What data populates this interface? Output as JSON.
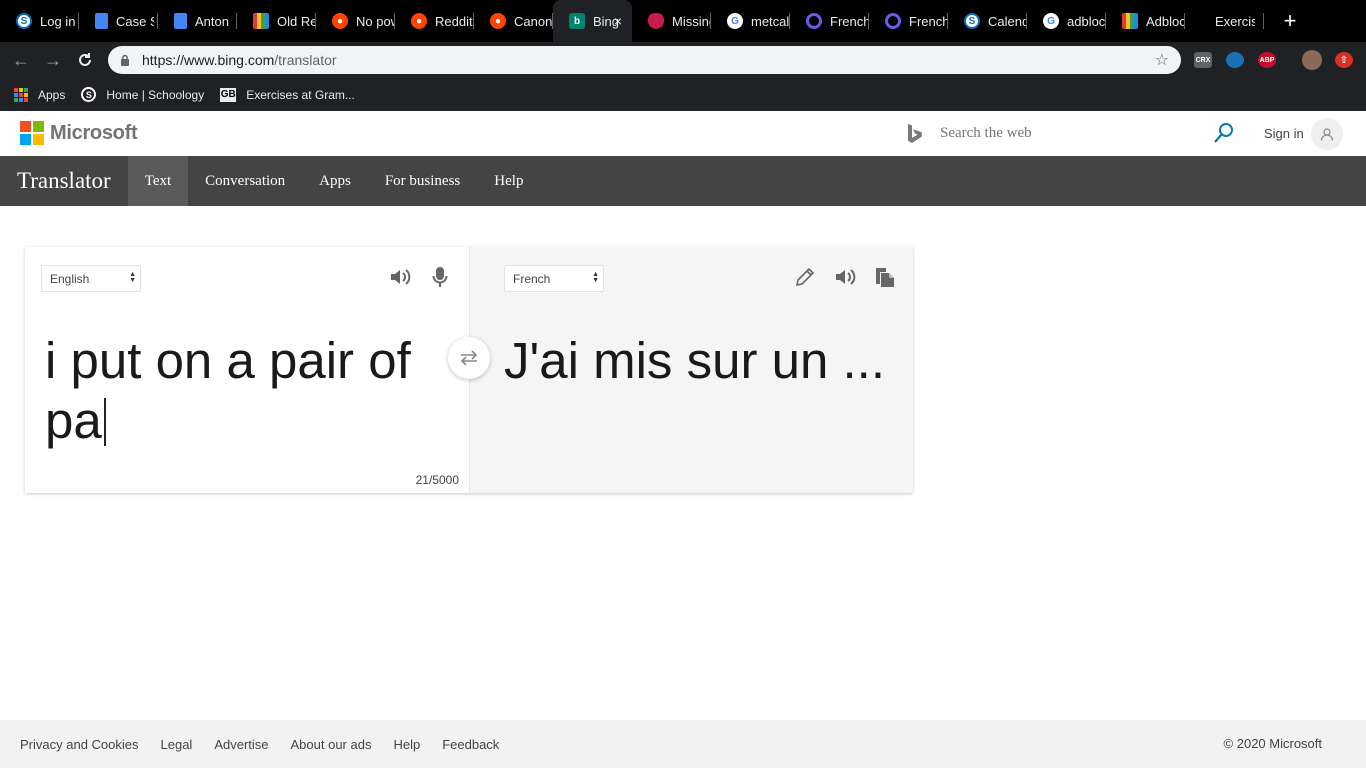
{
  "browser": {
    "tabs": [
      {
        "title": "Log in t",
        "icon": "schoology-icon",
        "kind": "s"
      },
      {
        "title": "Case S",
        "icon": "docs-icon",
        "kind": "doc"
      },
      {
        "title": "Anton V",
        "icon": "docs-icon",
        "kind": "doc"
      },
      {
        "title": "Old Re",
        "icon": "rainbow-icon",
        "kind": "rain"
      },
      {
        "title": "No pow",
        "icon": "reddit-icon",
        "kind": "reddit"
      },
      {
        "title": "Reddit",
        "icon": "reddit-icon",
        "kind": "reddit"
      },
      {
        "title": "Canon",
        "icon": "reddit-icon",
        "kind": "reddit"
      },
      {
        "title": "Bing",
        "icon": "bing-icon",
        "kind": "bing",
        "active": true
      },
      {
        "title": "Missing",
        "icon": "raspberry-icon",
        "kind": "rasp"
      },
      {
        "title": "metcal",
        "icon": "google-icon",
        "kind": "goog"
      },
      {
        "title": "French",
        "icon": "quizlet-icon",
        "kind": "q"
      },
      {
        "title": "French",
        "icon": "quizlet-icon",
        "kind": "q"
      },
      {
        "title": "Calend",
        "icon": "schoology-icon",
        "kind": "s"
      },
      {
        "title": "adbloc",
        "icon": "google-icon",
        "kind": "goog"
      },
      {
        "title": "Adbloc",
        "icon": "rainbow-icon",
        "kind": "rain"
      },
      {
        "title": "Exercis",
        "icon": "blank-icon",
        "kind": "none"
      }
    ],
    "close_tab": "×",
    "new_tab": "+",
    "url_host": "https://www.bing.com",
    "url_path": "/translator",
    "extensions": [
      "CRX",
      "ABP"
    ],
    "bookmarks": [
      {
        "label": "Apps"
      },
      {
        "label": "Home | Schoology"
      },
      {
        "label": "Exercises at Gram..."
      }
    ]
  },
  "header": {
    "brand": "Microsoft",
    "search_placeholder": "Search the web",
    "signin": "Sign in"
  },
  "nav": {
    "brand": "Translator",
    "items": [
      "Text",
      "Conversation",
      "Apps",
      "For business",
      "Help"
    ]
  },
  "translator": {
    "source_lang": "English",
    "target_lang": "French",
    "source_text": "i put on a pair of pa",
    "target_text": "J'ai mis sur un  ...",
    "char_count": "21/5000"
  },
  "footer": {
    "links": [
      "Privacy and Cookies",
      "Legal",
      "Advertise",
      "About our ads",
      "Help",
      "Feedback"
    ],
    "copyright": "© 2020 Microsoft"
  },
  "colors": {
    "nav_bg": "#444444",
    "nav_active": "#5a5a5a",
    "target_pane_bg": "#f5f5f5",
    "footer_bg": "#f2f2f2",
    "search_accent": "#007daa"
  }
}
